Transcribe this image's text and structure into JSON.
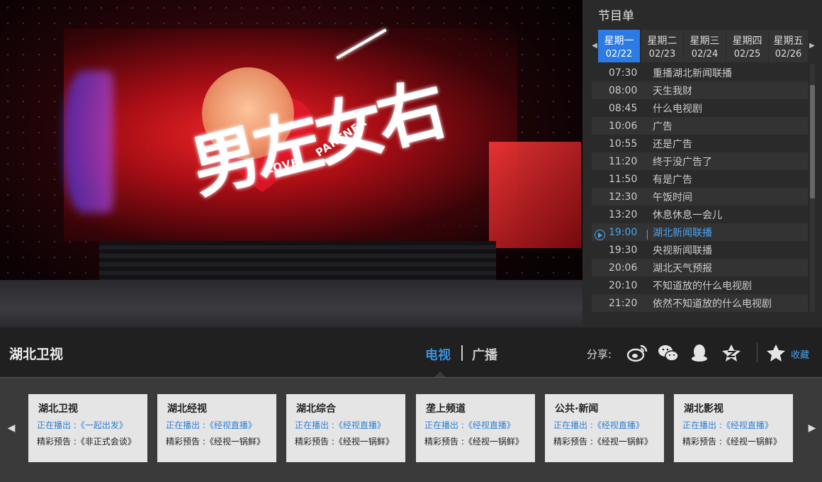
{
  "schedule": {
    "title": "节目单",
    "days": [
      {
        "name": "星期一",
        "date": "02/22"
      },
      {
        "name": "星期二",
        "date": "02/23"
      },
      {
        "name": "星期三",
        "date": "02/24"
      },
      {
        "name": "星期四",
        "date": "02/25"
      },
      {
        "name": "星期五",
        "date": "02/26"
      }
    ],
    "programs": [
      {
        "time": "07:30",
        "title": "重播湖北新闻联播"
      },
      {
        "time": "08:00",
        "title": "天生我财"
      },
      {
        "time": "08:45",
        "title": "什么电视剧"
      },
      {
        "time": "10:06",
        "title": "广告"
      },
      {
        "time": "10:55",
        "title": "还是广告"
      },
      {
        "time": "11:20",
        "title": "终于没广告了"
      },
      {
        "time": "11:50",
        "title": "有是广告"
      },
      {
        "time": "12:30",
        "title": "午饭时间"
      },
      {
        "time": "13:20",
        "title": "休息休息一会儿"
      },
      {
        "time": "19:00",
        "title": "湖北新闻联播"
      },
      {
        "time": "19:30",
        "title": "央视新闻联播"
      },
      {
        "time": "20:06",
        "title": "湖北天气预报"
      },
      {
        "time": "20:10",
        "title": "不知道放的什么电视剧"
      },
      {
        "time": "21:20",
        "title": "依然不知道放的什么电视剧"
      }
    ]
  },
  "video": {
    "logo_main": "男左女右",
    "logo_love": "LOVE",
    "logo_partner": "PARTNER"
  },
  "bar": {
    "channel": "湖北卫视",
    "tab_tv": "电视",
    "tab_radio": "广播",
    "share_label": "分享:",
    "favorite": "收藏"
  },
  "cards": [
    {
      "name": "湖北卫视",
      "now": "正在播出 :《一起出发》",
      "next": "精彩预告 :《非正式会谈》"
    },
    {
      "name": "湖北经视",
      "now": "正在播出 :《经视直播》",
      "next": "精彩预告 :《经视一锅鲜》"
    },
    {
      "name": "湖北综合",
      "now": "正在播出 :《经视直播》",
      "next": "精彩预告 :《经视一锅鲜》"
    },
    {
      "name": "垄上频道",
      "now": "正在播出 :《经视直播》",
      "next": "精彩预告 :《经视一锅鲜》"
    },
    {
      "name": "公共·新闻",
      "now": "正在播出 :《经视直播》",
      "next": "精彩预告 :《经视一锅鲜》"
    },
    {
      "name": "湖北影视",
      "now": "正在播出 :《经视直播》",
      "next": "精彩预告 :《经视一锅鲜》"
    }
  ],
  "colors": {
    "accent": "#2c7be5",
    "link": "#4aa3f0"
  }
}
